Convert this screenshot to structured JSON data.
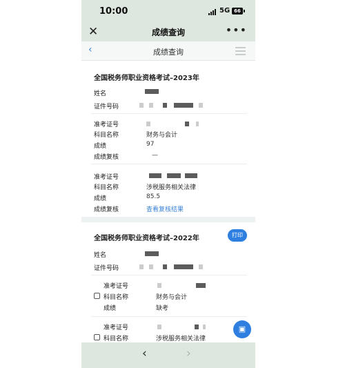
{
  "status_bar": {
    "time": "10:00",
    "network": "5G",
    "battery": "66"
  },
  "top_bar": {
    "close_icon": "close-icon",
    "title": "成绩查询",
    "more_icon": "more-icon"
  },
  "nav_bar": {
    "back_icon": "back-chevron-icon",
    "title": "成绩查询",
    "menu_icon": "menu-icon"
  },
  "section_2023": {
    "title": "全国税务师职业资格考试–2023年",
    "name_label": "姓名",
    "id_label": "证件号码",
    "subjects": [
      {
        "ticket_label": "准考证号",
        "subject_label": "科目名称",
        "subject_value": "财务与会计",
        "score_label": "成绩",
        "score_value": "97",
        "review_label": "成绩复核",
        "review_value": "—"
      },
      {
        "ticket_label": "准考证号",
        "subject_label": "科目名称",
        "subject_value": "涉税服务相关法律",
        "score_label": "成绩",
        "score_value": "85.5",
        "review_label": "成绩复核",
        "review_value": "查看复核结果"
      }
    ]
  },
  "section_2022": {
    "title": "全国税务师职业资格考试–2022年",
    "print_label": "打印",
    "name_label": "姓名",
    "id_label": "证件号码",
    "subjects": [
      {
        "ticket_label": "准考证号",
        "subject_label": "科目名称",
        "subject_value": "财务与会计",
        "score_label": "成绩",
        "score_value": "缺考"
      },
      {
        "ticket_label": "准考证号",
        "subject_label": "科目名称",
        "subject_value": "涉税服务相关法律"
      }
    ]
  },
  "float_button": {
    "icon": "save-icon"
  },
  "bottom_bar": {
    "prev_icon": "chevron-left-icon",
    "next_icon": "chevron-right-icon"
  },
  "colors": {
    "accent": "#2f7fe0",
    "link": "#3b83d8",
    "header_bg": "#dde7df"
  }
}
